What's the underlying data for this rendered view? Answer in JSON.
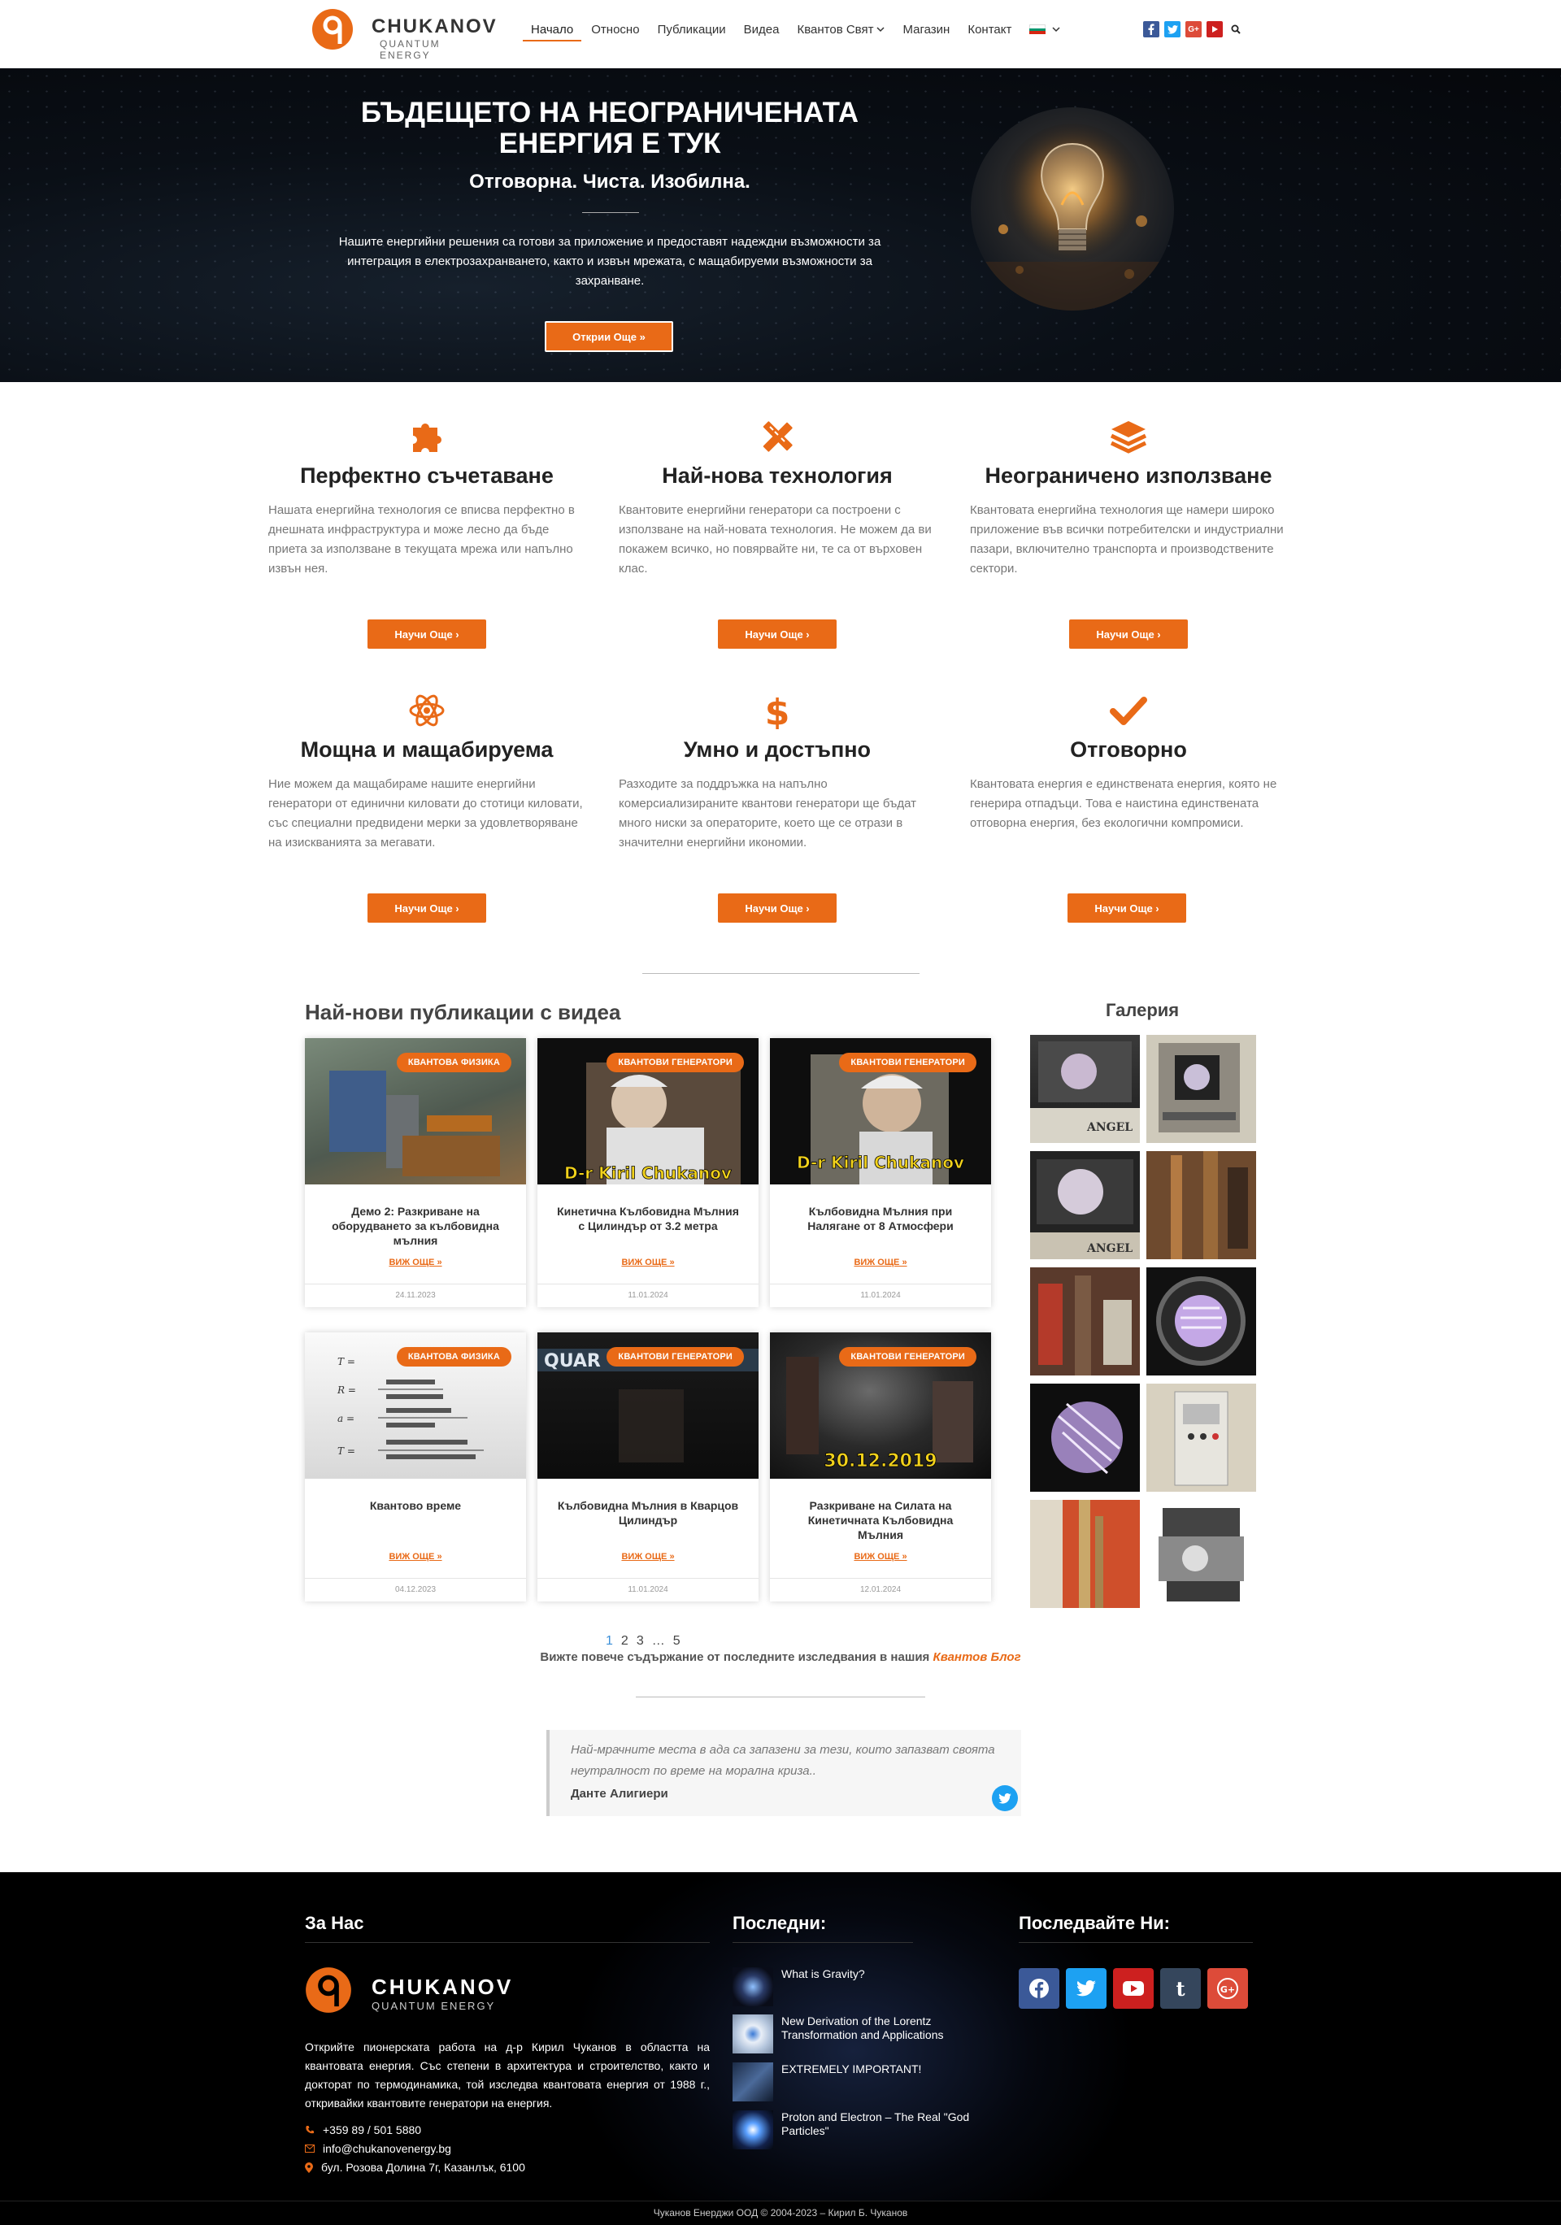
{
  "header": {
    "brand": "CHUKANOV",
    "brand_sub": "QUANTUM ENERGY",
    "nav": [
      "Начало",
      "Относно",
      "Публикации",
      "Видеа",
      "Квантов Свят",
      "Магазин",
      "Контакт"
    ],
    "social_icons": [
      "facebook-icon",
      "twitter-icon",
      "google-plus-icon",
      "youtube-icon"
    ],
    "accent": "#e96a17"
  },
  "hero": {
    "title": "БЪДЕЩЕТО НА НЕОГРАНИЧЕНАТА ЕНЕРГИЯ Е ТУК",
    "subtitle": "Отговорна. Чиста. Изобилна.",
    "text": "Нашите енергийни решения са готови за приложение и предоставят надеждни възможности за интеграция в електрозахранването, както и извън мрежата, с мащабируеми възможности за захранване.",
    "button": "Открии Още »"
  },
  "features": [
    {
      "icon": "puzzle-icon",
      "title": "Перфектно съчетаване",
      "text": "Нашата енергийна технология се вписва перфектно в днешната инфраструктура и може лесно да бъде приета за използване в текущата мрежа или напълно извън нея.",
      "button": "Научи Още ›"
    },
    {
      "icon": "pencil-ruler-icon",
      "title": "Най-нова технология",
      "text": "Квантовите енергийни генератори са построени с използване на най-новата технология. Не можем да ви покажем всичко, но повярвайте ни, те са от върховен клас.",
      "button": "Научи Още ›"
    },
    {
      "icon": "layers-icon",
      "title": "Неограничено използване",
      "text": "Квантовата енергийна технология ще намери широко приложение във всички потребителски и индустриални пазари, включително транспорта и производствените сектори.",
      "button": "Научи Още ›"
    },
    {
      "icon": "atom-icon",
      "title": "Мощна и мащабируема",
      "text": "Ние можем да мащабираме нашите енергийни генератори от единични киловати до стотици киловати, със специални предвидени мерки за удовлетворяване на изискванията за мегавати.",
      "button": "Научи Още ›"
    },
    {
      "icon": "dollar-icon",
      "title": "Умно и достъпно",
      "text": "Разходите за поддръжка на напълно комерсиализираните квантови генератори ще бъдат много ниски за операторите, което ще се отрази в значителни енергийни икономии.",
      "button": "Научи Още ›"
    },
    {
      "icon": "check-icon",
      "title": "Отговорно",
      "text": "Квантовата енергия е единствената енергия, която не генерира отпадъци. Това е наистина единствената отговорна енергия, без екологични компромиси.",
      "button": "Научи Още ›"
    }
  ],
  "publications": {
    "title": "Най-нови публикации с видеа",
    "read_more": "ВИЖ ОЩЕ »",
    "cards": [
      {
        "badge": "КВАНТОВА ФИЗИКА",
        "title": "Демо 2: Разкриване на оборудването за кълбовидна мълния",
        "date": "24.11.2023"
      },
      {
        "badge": "КВАНТОВИ ГЕНЕРАТОРИ",
        "title": "Кинетична Кълбовидна Мълния с Цилиндър от 3.2 метра",
        "date": "11.01.2024",
        "caption": "D-r Kiril Chukanov"
      },
      {
        "badge": "КВАНТОВИ ГЕНЕРАТОРИ",
        "title": "Кълбовидна Мълния при Налягане от 8 Атмосфери",
        "date": "11.01.2024",
        "caption": "D-r Kiril Chukanov"
      },
      {
        "badge": "КВАНТОВА ФИЗИКА",
        "title": "Квантово време",
        "date": "04.12.2023"
      },
      {
        "badge": "КВАНТОВИ ГЕНЕРАТОРИ",
        "title": "Кълбовидна Мълния в Кварцов Цилиндър",
        "date": "11.01.2024",
        "caption": "QUAR"
      },
      {
        "badge": "КВАНТОВИ ГЕНЕРАТОРИ",
        "title": "Разкриване на Силата на Кинетичната Кълбовидна Мълния",
        "date": "12.01.2024",
        "caption": "30.12.2019"
      }
    ],
    "pagination": [
      "1",
      "2",
      "3",
      "…",
      "5"
    ],
    "more_text": "Вижте повече съдържание от последните изследвания в нашия",
    "more_link": "Квантов Блог"
  },
  "gallery": {
    "title": "Галерия",
    "thumb_caption": "ANGEL"
  },
  "quote": {
    "text": "Най-мрачните места в ада са запазени за тези, които запазват своята неутралност по време на морална криза..",
    "author": "Данте Алигиери"
  },
  "footer": {
    "about_title": "За Нас",
    "latest_title": "Последни:",
    "follow_title": "Последвайте Ни:",
    "about_text": "Открийте пионерската работа на д-р Кирил Чуканов в областта на квантовата енергия. Със степени в архитектура и строителство, както и докторат по термодинамика, той изследва квантовата енергия от 1988 г., откривайки квантовите генератори на енергия.",
    "phone": "+359 89 / 501 5880",
    "email": "info@chukanovenergy.bg",
    "address": "бул. Розова Долина 7г, Казанлък, 6100",
    "latest": [
      "What is Gravity?",
      "New Derivation of the Lorentz Transformation and Applications",
      "EXTREMELY IMPORTANT!",
      "Proton and Electron – The Real \"God Particles\""
    ],
    "follow_icons": [
      {
        "icon": "facebook-icon",
        "color": "#3b5998"
      },
      {
        "icon": "twitter-icon",
        "color": "#1da1f2"
      },
      {
        "icon": "youtube-icon",
        "color": "#cd201f"
      },
      {
        "icon": "tumblr-icon",
        "color": "#35465c"
      },
      {
        "icon": "google-plus-icon",
        "color": "#dd4b39"
      }
    ],
    "copyright": "Чуканов Енерджи ООД © 2004-2023 – Кирил Б. Чуканов"
  }
}
